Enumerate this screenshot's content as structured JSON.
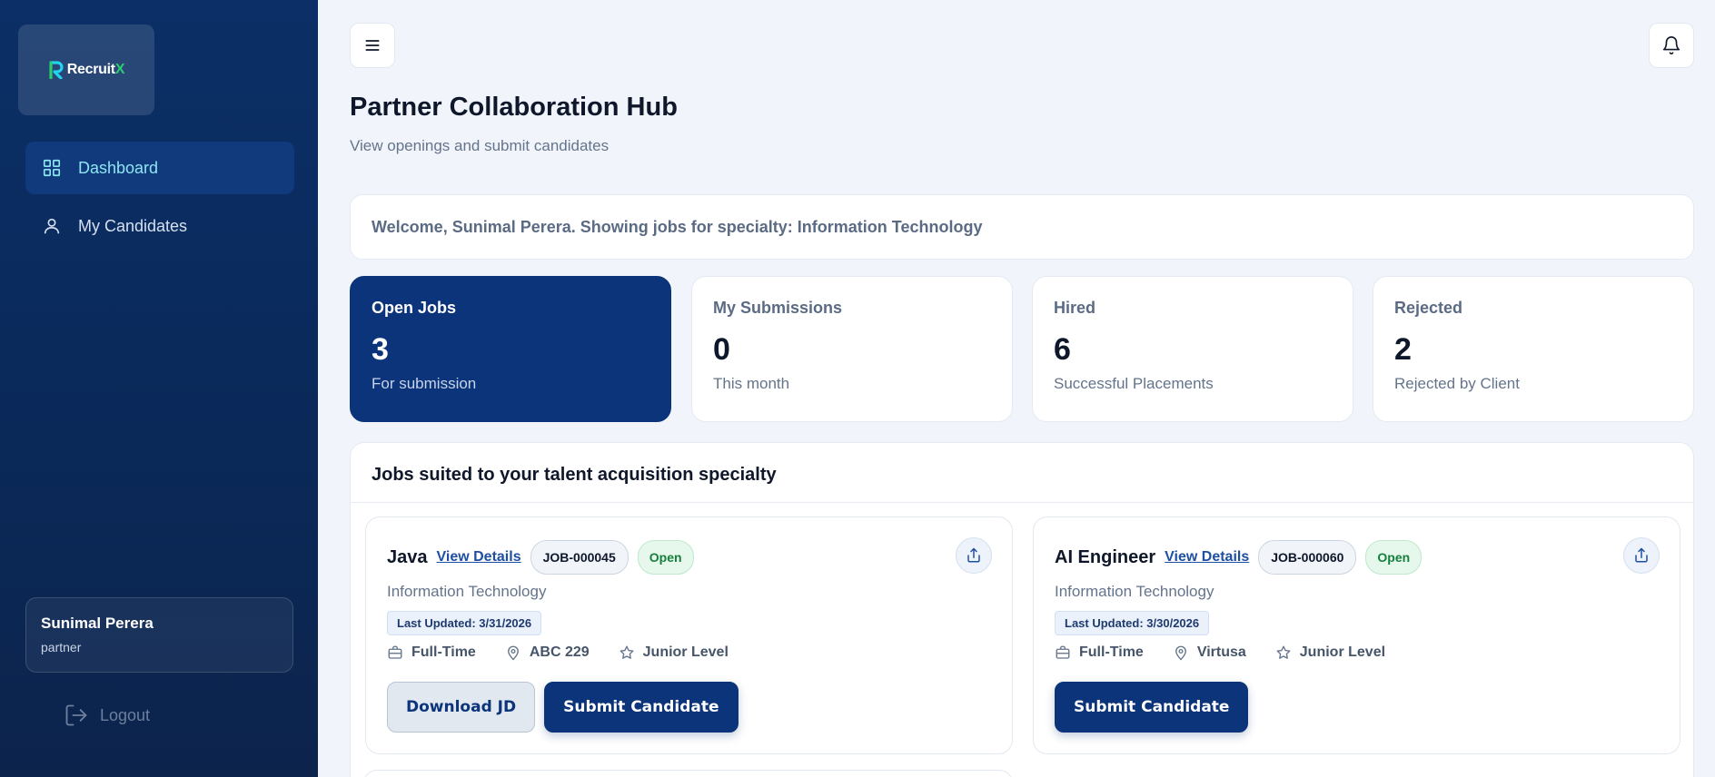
{
  "app": {
    "logo_main": "Recruit",
    "logo_accent": "X"
  },
  "sidebar": {
    "items": [
      {
        "label": "Dashboard",
        "icon": "dashboard-grid-icon",
        "active": true
      },
      {
        "label": "My Candidates",
        "icon": "user-icon",
        "active": false
      }
    ],
    "user": {
      "name": "Sunimal Perera",
      "role": "partner"
    },
    "logout_label": "Logout"
  },
  "header": {
    "title": "Partner Collaboration Hub",
    "subtitle": "View openings and submit candidates"
  },
  "welcome": "Welcome, Sunimal Perera. Showing jobs for specialty: Information Technology",
  "stats": [
    {
      "label": "Open Jobs",
      "value": "3",
      "desc": "For submission"
    },
    {
      "label": "My Submissions",
      "value": "0",
      "desc": "This month"
    },
    {
      "label": "Hired",
      "value": "6",
      "desc": "Successful Placements"
    },
    {
      "label": "Rejected",
      "value": "2",
      "desc": "Rejected by Client"
    }
  ],
  "jobs_section": {
    "title": "Jobs suited to your talent acquisition specialty",
    "jobs": [
      {
        "title": "Java",
        "view_label": "View Details",
        "job_id": "JOB-000045",
        "status": "Open",
        "department": "Information Technology",
        "updated": "Last Updated: 3/31/2026",
        "type": "Full-Time",
        "location": "ABC 229",
        "level": "Junior Level",
        "download_label": "Download JD",
        "submit_label": "Submit Candidate"
      },
      {
        "title": "AI Engineer",
        "view_label": "View Details",
        "job_id": "JOB-000060",
        "status": "Open",
        "department": "Information Technology",
        "updated": "Last Updated: 3/30/2026",
        "type": "Full-Time",
        "location": "Virtusa",
        "level": "Junior Level",
        "submit_label": "Submit Candidate"
      }
    ]
  },
  "colors": {
    "sidebar": "#0b2f66",
    "primary": "#0b347a",
    "accent": "#8ee6f2",
    "open_green": "#15803d"
  }
}
